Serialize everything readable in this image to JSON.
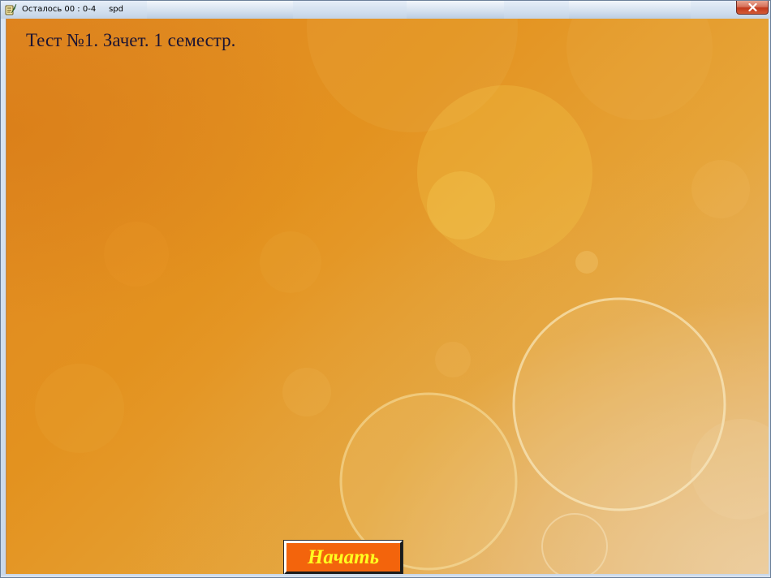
{
  "window": {
    "title": "Осталось 00 : 0-4     spd",
    "app_icon": "scroll-quill-icon",
    "close_icon": "close-icon",
    "close_color": "#c2391d"
  },
  "main": {
    "title": "Тест №1. Зачет. 1 семестр.",
    "background": "orange-bokeh",
    "start_button_label": "Начать",
    "start_button_color": "#f3640c",
    "start_button_text_color": "#ffff20"
  }
}
